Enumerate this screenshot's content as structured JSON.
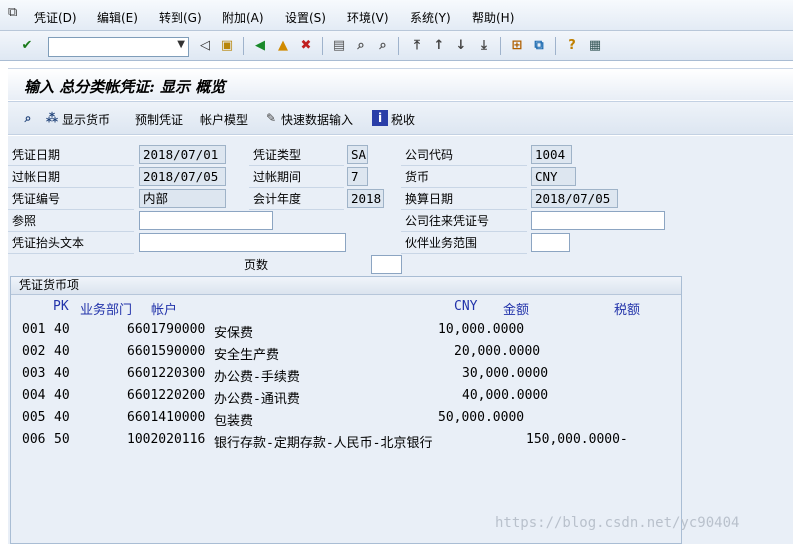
{
  "menu": {
    "items": [
      "凭证(D)",
      "编辑(E)",
      "转到(G)",
      "附加(A)",
      "设置(S)",
      "环境(V)",
      "系统(Y)",
      "帮助(H)"
    ]
  },
  "toolbar": {
    "command_value": "",
    "icons": [
      "check-icon",
      "save-icon",
      "back-icon",
      "exit-icon",
      "cancel-icon",
      "print-icon",
      "find-icon",
      "find-next-icon",
      "first-page-icon",
      "prev-page-icon",
      "next-page-icon",
      "last-page-icon",
      "create-session-icon",
      "shortcut-icon",
      "help-icon",
      "layout-icon"
    ]
  },
  "title": "输入 总分类帐凭证: 显示 概览",
  "app_toolbar": {
    "display_currency": "显示货币",
    "park": "预制凭证",
    "account_model": "帐户模型",
    "fast_entry": "快速数据输入",
    "tax": "税收"
  },
  "header": {
    "doc_date_label": "凭证日期",
    "doc_date": "2018/07/01",
    "doc_type_label": "凭证类型",
    "doc_type": "SA",
    "company_code_label": "公司代码",
    "company_code": "1004",
    "posting_date_label": "过帐日期",
    "posting_date": "2018/07/05",
    "period_label": "过帐期间",
    "period": "7",
    "currency_label": "货币",
    "currency": "CNY",
    "doc_number_label": "凭证编号",
    "doc_number": "内部",
    "fiscal_year_label": "会计年度",
    "fiscal_year": "2018",
    "translation_date_label": "换算日期",
    "translation_date": "2018/07/05",
    "reference_label": "参照",
    "reference": "",
    "intercompany_label": "公司往来凭证号",
    "intercompany": "",
    "header_text_label": "凭证抬头文本",
    "header_text": "",
    "partner_ba_label": "伙伴业务范围",
    "partner_ba": "",
    "page_label": "页数",
    "page": ""
  },
  "items_panel": {
    "title": "凭证货币项",
    "columns": {
      "pk": "PK",
      "ba": "业务部门",
      "account": "帐户",
      "cny": "CNY",
      "amount": "金额",
      "tax": "税额"
    },
    "rows": [
      {
        "no": "001",
        "pk": "40",
        "account": "6601790000",
        "text": "安保费",
        "amount": "10,000.0000"
      },
      {
        "no": "002",
        "pk": "40",
        "account": "6601590000",
        "text": "安全生产费",
        "amount": "20,000.0000"
      },
      {
        "no": "003",
        "pk": "40",
        "account": "6601220300",
        "text": "办公费-手续费",
        "amount": "30,000.0000"
      },
      {
        "no": "004",
        "pk": "40",
        "account": "6601220200",
        "text": "办公费-通讯费",
        "amount": "40,000.0000"
      },
      {
        "no": "005",
        "pk": "40",
        "account": "6601410000",
        "text": "包装费",
        "amount": "50,000.0000"
      },
      {
        "no": "006",
        "pk": "50",
        "account": "1002020116",
        "text": "银行存款-定期存款-人民币-北京银行",
        "amount": "150,000.0000-"
      }
    ]
  },
  "watermark": "https://blog.csdn.net/yc90404"
}
